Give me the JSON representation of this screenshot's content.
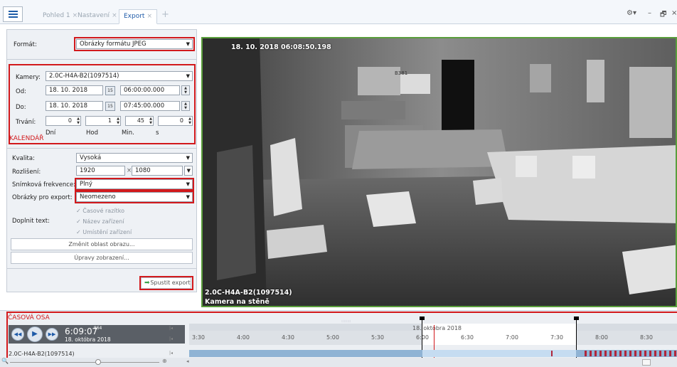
{
  "tabs": [
    {
      "label": "Pohled 1",
      "close": "×"
    },
    {
      "label": "Nastavení",
      "close": "×"
    },
    {
      "label": "Export",
      "close": "×"
    }
  ],
  "tab_add": "+",
  "window_controls": {
    "settings": "⚙▾",
    "minimize": "–",
    "restore": "🗗",
    "close": "×"
  },
  "format": {
    "label": "Formát:",
    "value": "Obrázky formátu JPEG"
  },
  "calendar": {
    "section_label": "KALENDÁŘ",
    "camera_label": "Kamery:",
    "camera_value": "2.0C-H4A-B2(1097514)",
    "from_label": "Od:",
    "from_date": "18. 10. 2018",
    "from_time": "06:00:00.000",
    "to_label": "Do:",
    "to_date": "18. 10. 2018",
    "to_time": "07:45:00.000",
    "duration_label": "Trvání:",
    "duration_values": [
      "0",
      "1",
      "45",
      "0"
    ],
    "duration_units": [
      "Dní",
      "Hod",
      "Min.",
      "s"
    ],
    "cal_icon": "15"
  },
  "quality": {
    "quality_label": "Kvalita:",
    "quality_value": "Vysoká",
    "resolution_label": "Rozlišení:",
    "res_w": "1920",
    "res_sep": "×",
    "res_h": "1080",
    "framerate_label": "Snímková frekvence:",
    "framerate_value": "Plný",
    "images_label": "Obrázky pro export:",
    "images_value": "Neomezeno",
    "add_text_label": "Doplnit text:",
    "checks": [
      "Časové razítko",
      "Název zařízení",
      "Umístění zařízení"
    ],
    "change_area": "Změnit oblast obrazu...",
    "display_adjust": "Úpravy zobrazení..."
  },
  "export_button": "Spustit export",
  "video": {
    "timestamp": "18. 10. 2018 06:08:50.198",
    "camera_name": "2.0C-H4A-B2(1097514)",
    "camera_location": "Kamera na stěně",
    "door_sign": "B381"
  },
  "timeline": {
    "title": "ČASOVÁ OSA",
    "time_main": "6:09:07",
    "time_ms": ".864",
    "date": "18. októbra 2018",
    "date_ruler": "18. októbra 2018",
    "camera": "2.0C-H4A-B2(1097514)",
    "ticks": [
      "3:30",
      "4:00",
      "4:30",
      "5:00",
      "5:30",
      "6:00",
      "6:30",
      "7:00",
      "7:30",
      "8:00",
      "8:30"
    ],
    "zoom_out": "🔍",
    "zoom_in": "⊕",
    "nav_first": "|◂",
    "nav_next": "▸|"
  },
  "colors": {
    "accent": "#1e5aa8",
    "highlight": "#d2191c",
    "video_border": "#5a9e3c",
    "export_icon": "#3aa34a"
  }
}
